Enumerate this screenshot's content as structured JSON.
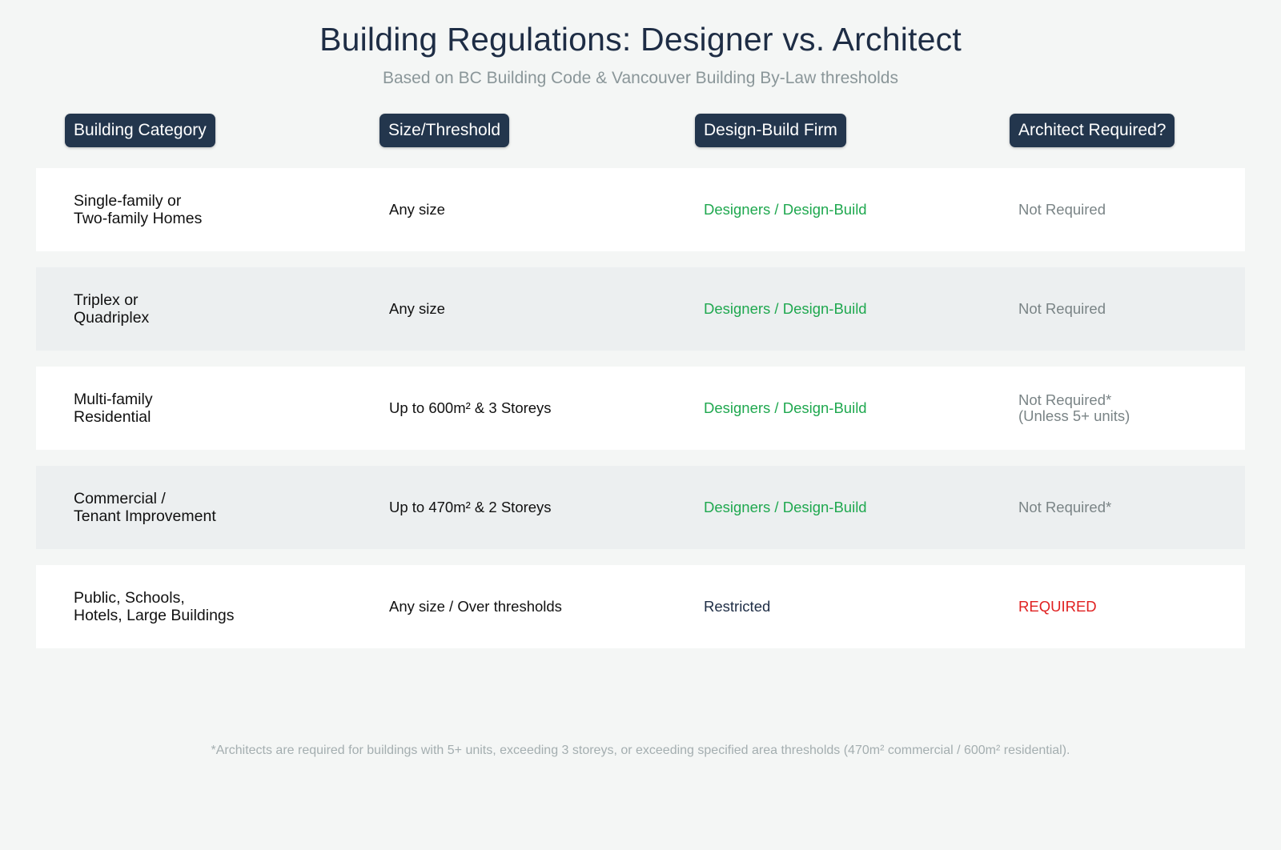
{
  "title": "Building Regulations: Designer vs. Architect",
  "subtitle": "Based on BC Building Code & Vancouver Building By-Law thresholds",
  "headers": [
    "Building Category",
    "Size/Threshold",
    "Design-Build Firm",
    "Architect Required?"
  ],
  "rows": [
    {
      "category_line1": "Single-family or",
      "category_line2": "Two-family Homes",
      "size": "Any size",
      "firm": "Designers / Design-Build",
      "architect_line1": "Not Required",
      "architect_line2": ""
    },
    {
      "category_line1": "Triplex or",
      "category_line2": "Quadriplex",
      "size": "Any size",
      "firm": "Designers / Design-Build",
      "architect_line1": "Not Required",
      "architect_line2": ""
    },
    {
      "category_line1": "Multi-family",
      "category_line2": "Residential",
      "size": "Up to 600m² & 3 Storeys",
      "firm": "Designers / Design-Build",
      "architect_line1": "Not Required*",
      "architect_line2": "(Unless 5+ units)"
    },
    {
      "category_line1": "Commercial /",
      "category_line2": "Tenant Improvement",
      "size": "Up to 470m² & 2 Storeys",
      "firm": "Designers / Design-Build",
      "architect_line1": "Not Required*",
      "architect_line2": ""
    },
    {
      "category_line1": "Public, Schools,",
      "category_line2": "Hotels, Large Buildings",
      "size": "Any size / Over thresholds",
      "firm": "Restricted",
      "architect_line1": "REQUIRED",
      "architect_line2": ""
    }
  ],
  "footnote": "*Architects are required for buildings with 5+ units, exceeding 3 storeys, or exceeding specified area thresholds (470m² commercial / 600m² residential).",
  "colors": {
    "header_bg": "#23364d",
    "title": "#1e2d45",
    "allowed_green": "#1fa84f",
    "not_required_gray": "#7a8486",
    "required_red": "#e02020",
    "restricted_navy": "#1e2d45"
  }
}
